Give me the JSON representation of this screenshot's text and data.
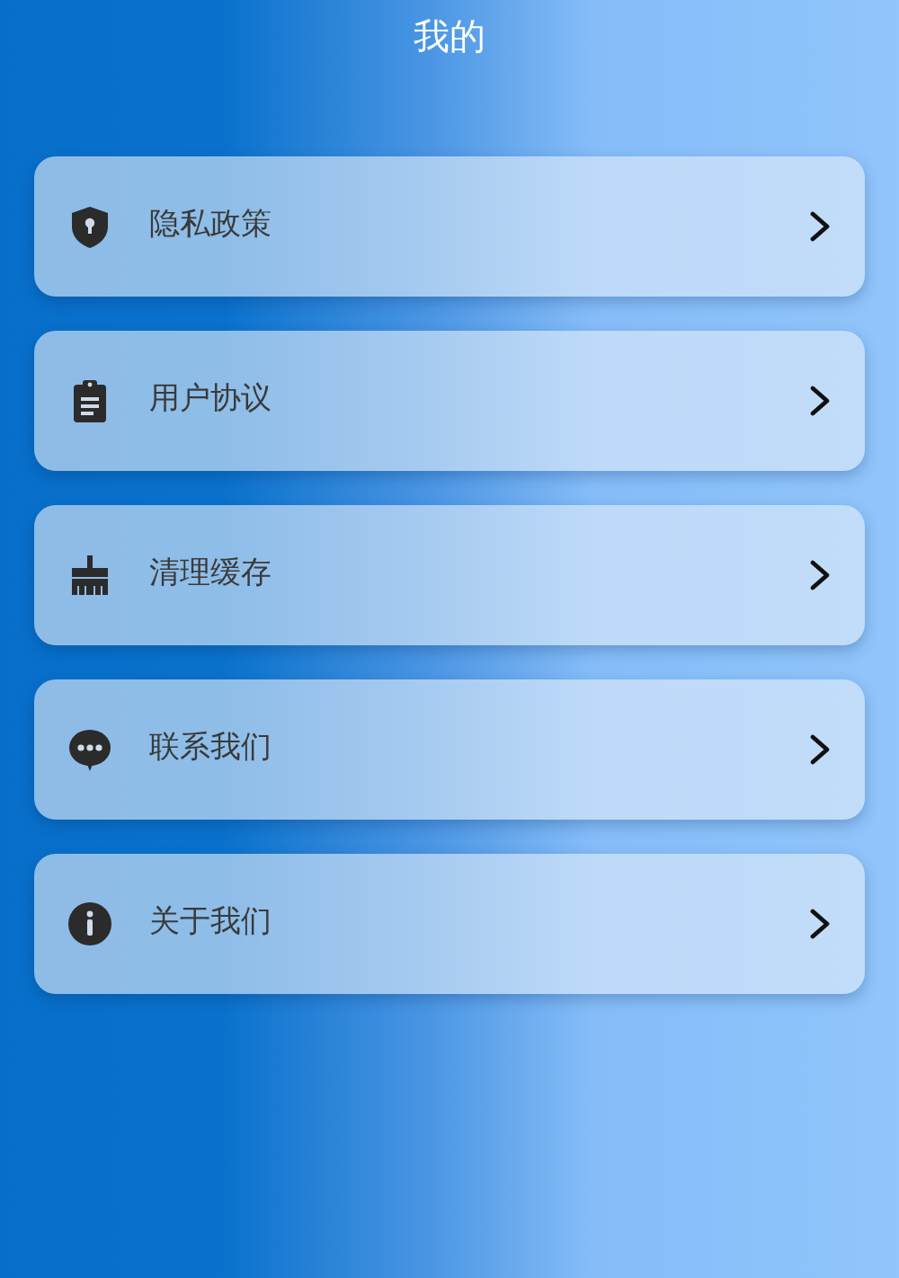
{
  "header": {
    "title": "我的"
  },
  "menu": [
    {
      "kind": "shield",
      "label": "隐私政策"
    },
    {
      "kind": "clipboard",
      "label": "用户协议"
    },
    {
      "kind": "brush",
      "label": "清理缓存"
    },
    {
      "kind": "chat",
      "label": "联系我们"
    },
    {
      "kind": "info",
      "label": "关于我们"
    }
  ]
}
